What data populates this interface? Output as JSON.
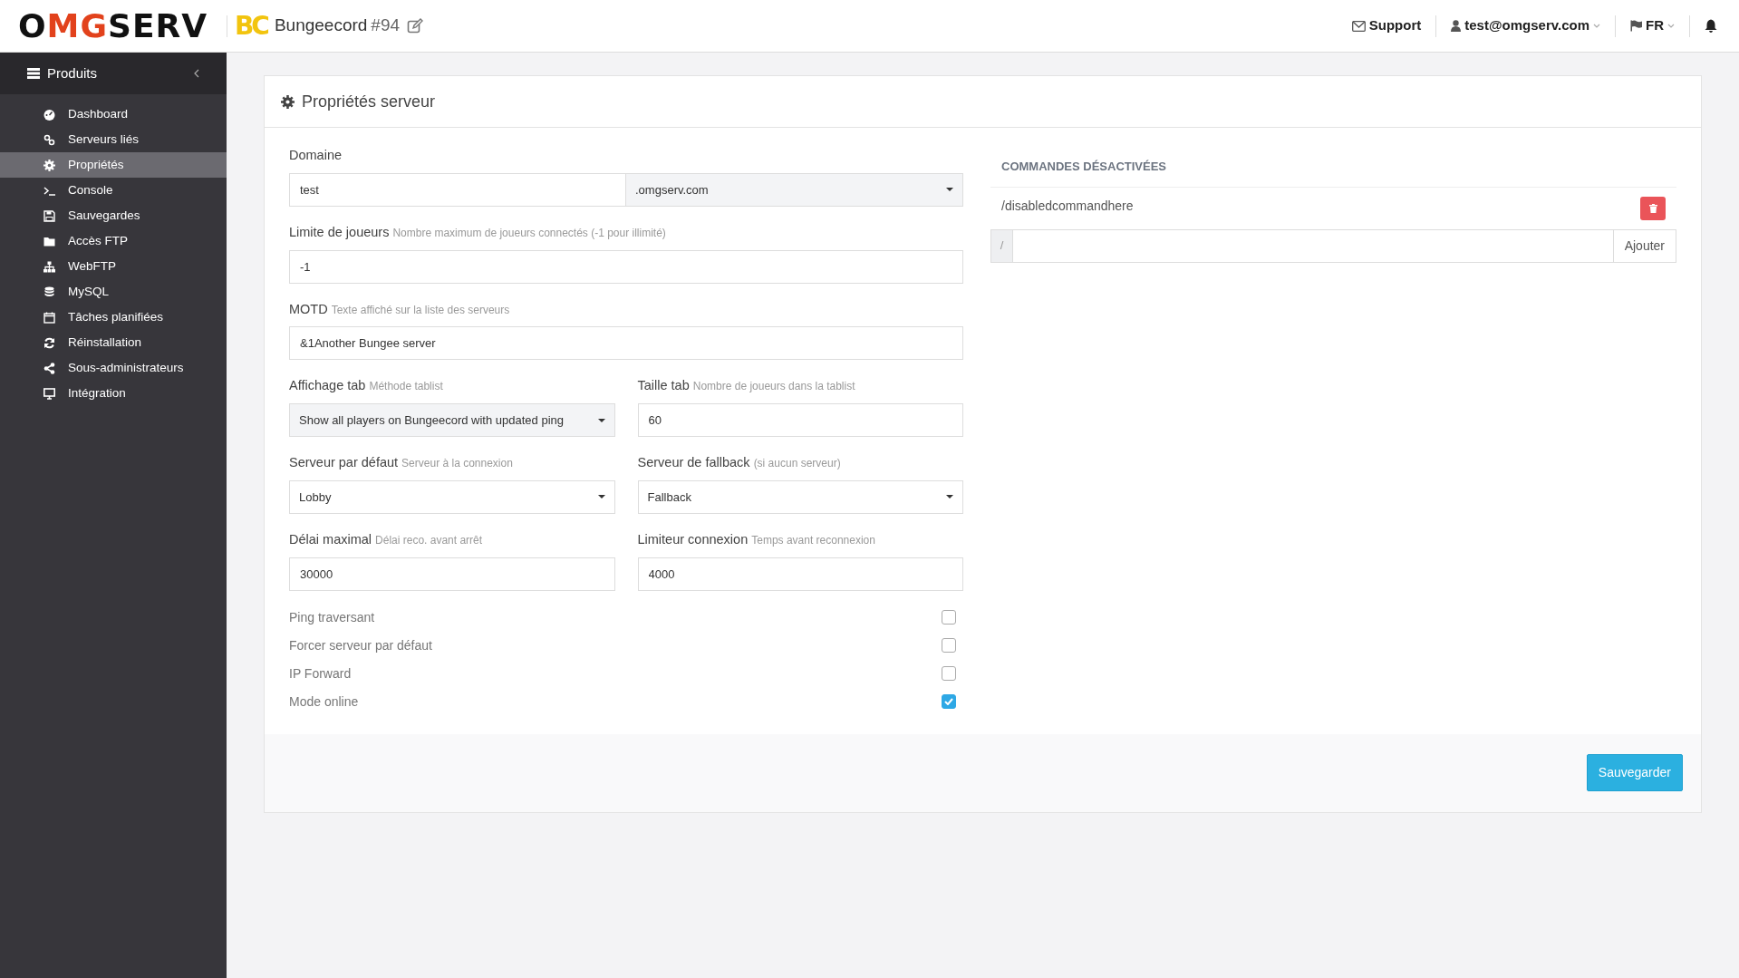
{
  "header": {
    "logo_parts": [
      {
        "text": "O",
        "color": "#111111"
      },
      {
        "text": "MG",
        "color": "#e2421c"
      },
      {
        "text": "SERV",
        "color": "#111111"
      }
    ],
    "server_badge": "BC",
    "server_name": "Bungeecord",
    "server_number": "#94",
    "nav": [
      {
        "kind": "support",
        "label": "Support"
      },
      {
        "kind": "user",
        "label": "test@omgserv.com"
      },
      {
        "kind": "lang",
        "label": "FR"
      },
      {
        "kind": "bell"
      }
    ]
  },
  "sidebar": {
    "title": "Produits",
    "items": [
      {
        "label": "Dashboard",
        "selected": false
      },
      {
        "label": "Serveurs liés",
        "selected": false
      },
      {
        "label": "Propriétés",
        "selected": true
      },
      {
        "label": "Console",
        "selected": false
      },
      {
        "label": "Sauvegardes",
        "selected": false
      },
      {
        "label": "Accès FTP",
        "selected": false
      },
      {
        "label": "WebFTP",
        "selected": false
      },
      {
        "label": "MySQL",
        "selected": false
      },
      {
        "label": "Tâches planifiées",
        "selected": false
      },
      {
        "label": "Réinstallation",
        "selected": false
      },
      {
        "label": "Sous-administrateurs",
        "selected": false
      },
      {
        "label": "Intégration",
        "selected": false
      }
    ]
  },
  "panel": {
    "title": "Propriétés serveur",
    "rows": [
      [
        {
          "kind": "domain",
          "label": "Domaine",
          "value": "test",
          "suffix": ".omgserv.com"
        }
      ],
      [
        {
          "kind": "input",
          "label": "Limite de joueurs",
          "hint": "Nombre maximum de joueurs connectés (-1 pour illimité)",
          "value": "-1"
        }
      ],
      [
        {
          "kind": "input",
          "label": "MOTD",
          "hint": "Texte affiché sur la liste des serveurs",
          "value": "&1Another Bungee server"
        }
      ],
      [
        {
          "kind": "select",
          "label": "Affichage tab",
          "hint": "Méthode tablist",
          "value": "Show all players on Bungeecord with updated ping",
          "disabled": true
        },
        {
          "kind": "input",
          "label": "Taille tab",
          "hint": "Nombre de joueurs dans la tablist",
          "value": "60"
        }
      ],
      [
        {
          "kind": "select",
          "label": "Serveur par défaut",
          "hint": "Serveur à la connexion",
          "value": "Lobby",
          "disabled": false
        },
        {
          "kind": "select",
          "label": "Serveur de fallback",
          "hint": "(si aucun serveur)",
          "value": "Fallback",
          "disabled": false
        }
      ],
      [
        {
          "kind": "input",
          "label": "Délai maximal",
          "hint": "Délai reco. avant arrêt",
          "value": "30000"
        },
        {
          "kind": "input",
          "label": "Limiteur connexion",
          "hint": "Temps avant reconnexion",
          "value": "4000"
        }
      ]
    ],
    "checkboxes": [
      {
        "label": "Ping traversant",
        "checked": false
      },
      {
        "label": "Forcer serveur par défaut",
        "checked": false
      },
      {
        "label": "IP Forward",
        "checked": false
      },
      {
        "label": "Mode online",
        "checked": true
      }
    ],
    "commands": {
      "title": "COMMANDES DÉSACTIVÉES",
      "items": [
        "/disabledcommandhere"
      ],
      "prefix": "/",
      "add_button": "Ajouter"
    },
    "save_button": "Sauvegarder"
  }
}
